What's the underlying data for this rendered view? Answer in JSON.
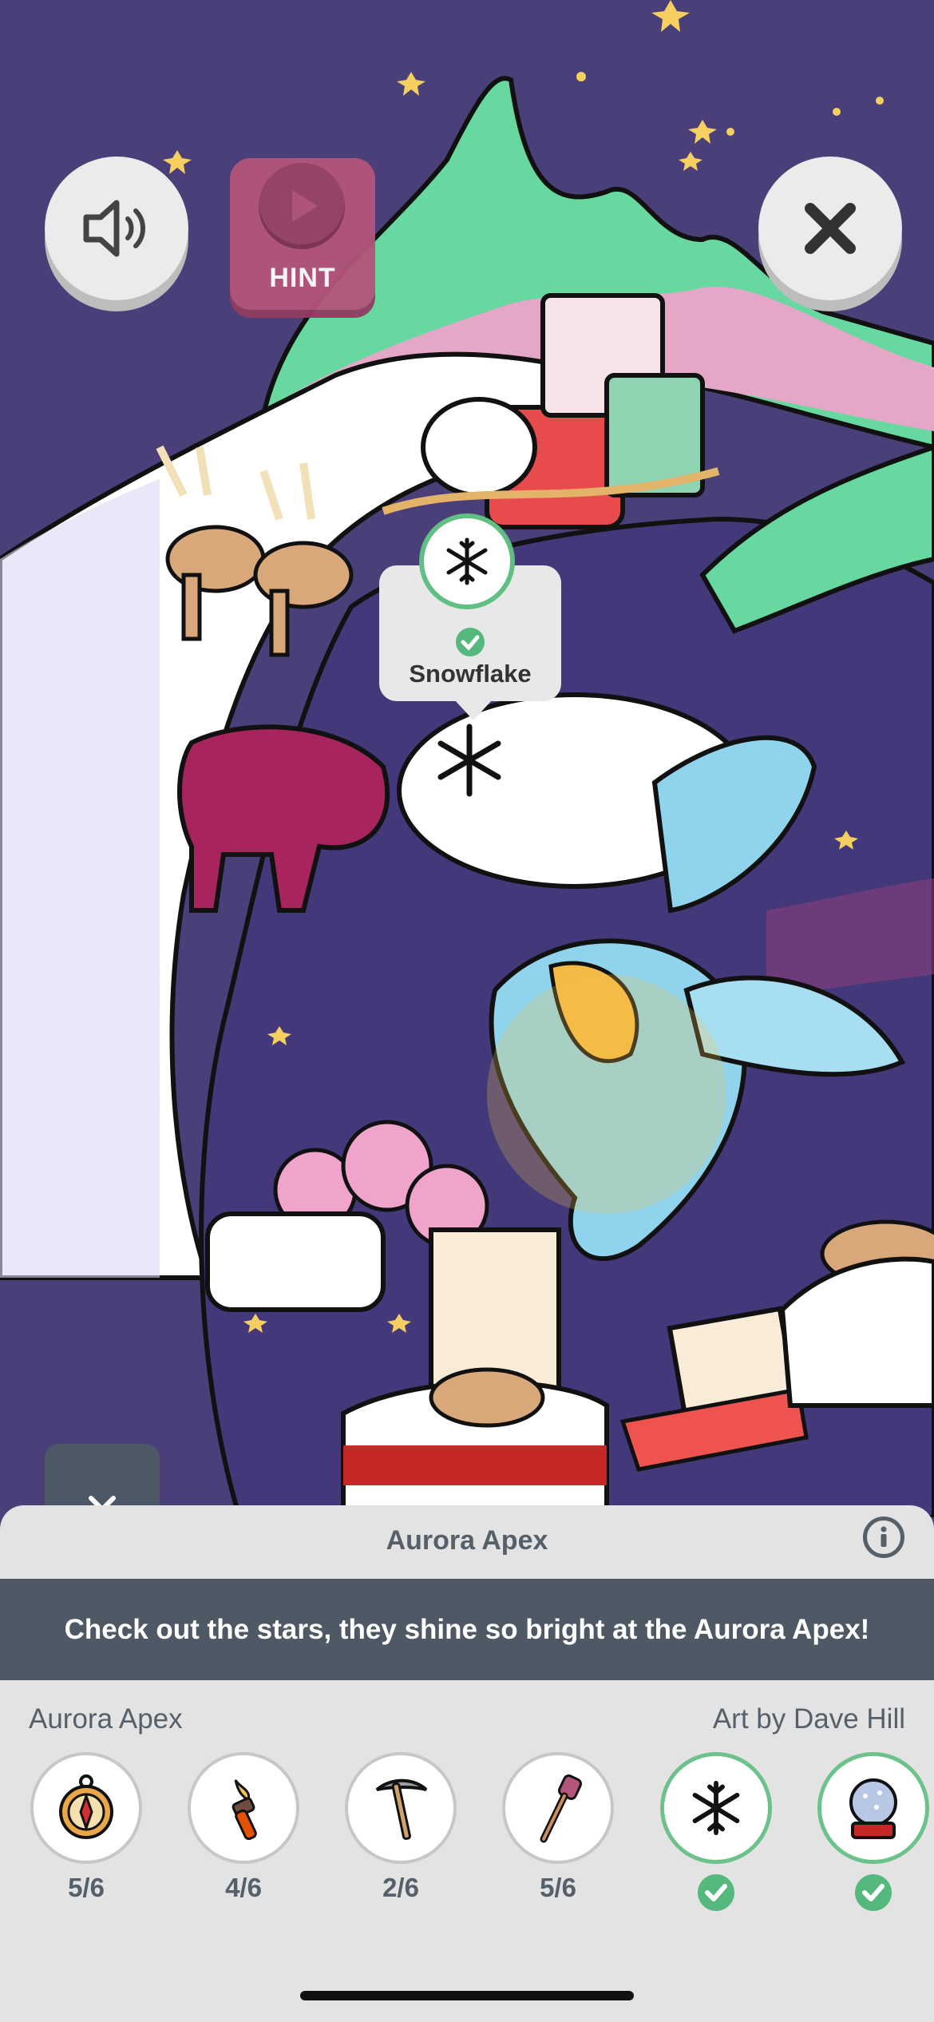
{
  "buttons": {
    "hint_label": "HINT"
  },
  "tooltip": {
    "item_name": "Snowflake",
    "found": true
  },
  "panel": {
    "title": "Aurora Apex",
    "message": "Check out the stars, they shine so bright at the Aurora Apex!",
    "scene_name": "Aurora Apex",
    "credit": "Art by Dave Hill"
  },
  "items": [
    {
      "icon": "compass-icon",
      "count": "5/6",
      "found": false
    },
    {
      "icon": "torch-icon",
      "count": "4/6",
      "found": false
    },
    {
      "icon": "pickaxe-icon",
      "count": "2/6",
      "found": false
    },
    {
      "icon": "marshmallow-stick-icon",
      "count": "5/6",
      "found": false
    },
    {
      "icon": "snowflake-icon",
      "count": "",
      "found": true
    },
    {
      "icon": "snow-globe-icon",
      "count": "",
      "found": true
    }
  ],
  "colors": {
    "background": "#4a3f78",
    "accent_green": "#55b87c",
    "hint_pink": "#b4557b",
    "panel_dark": "#4f5965"
  }
}
